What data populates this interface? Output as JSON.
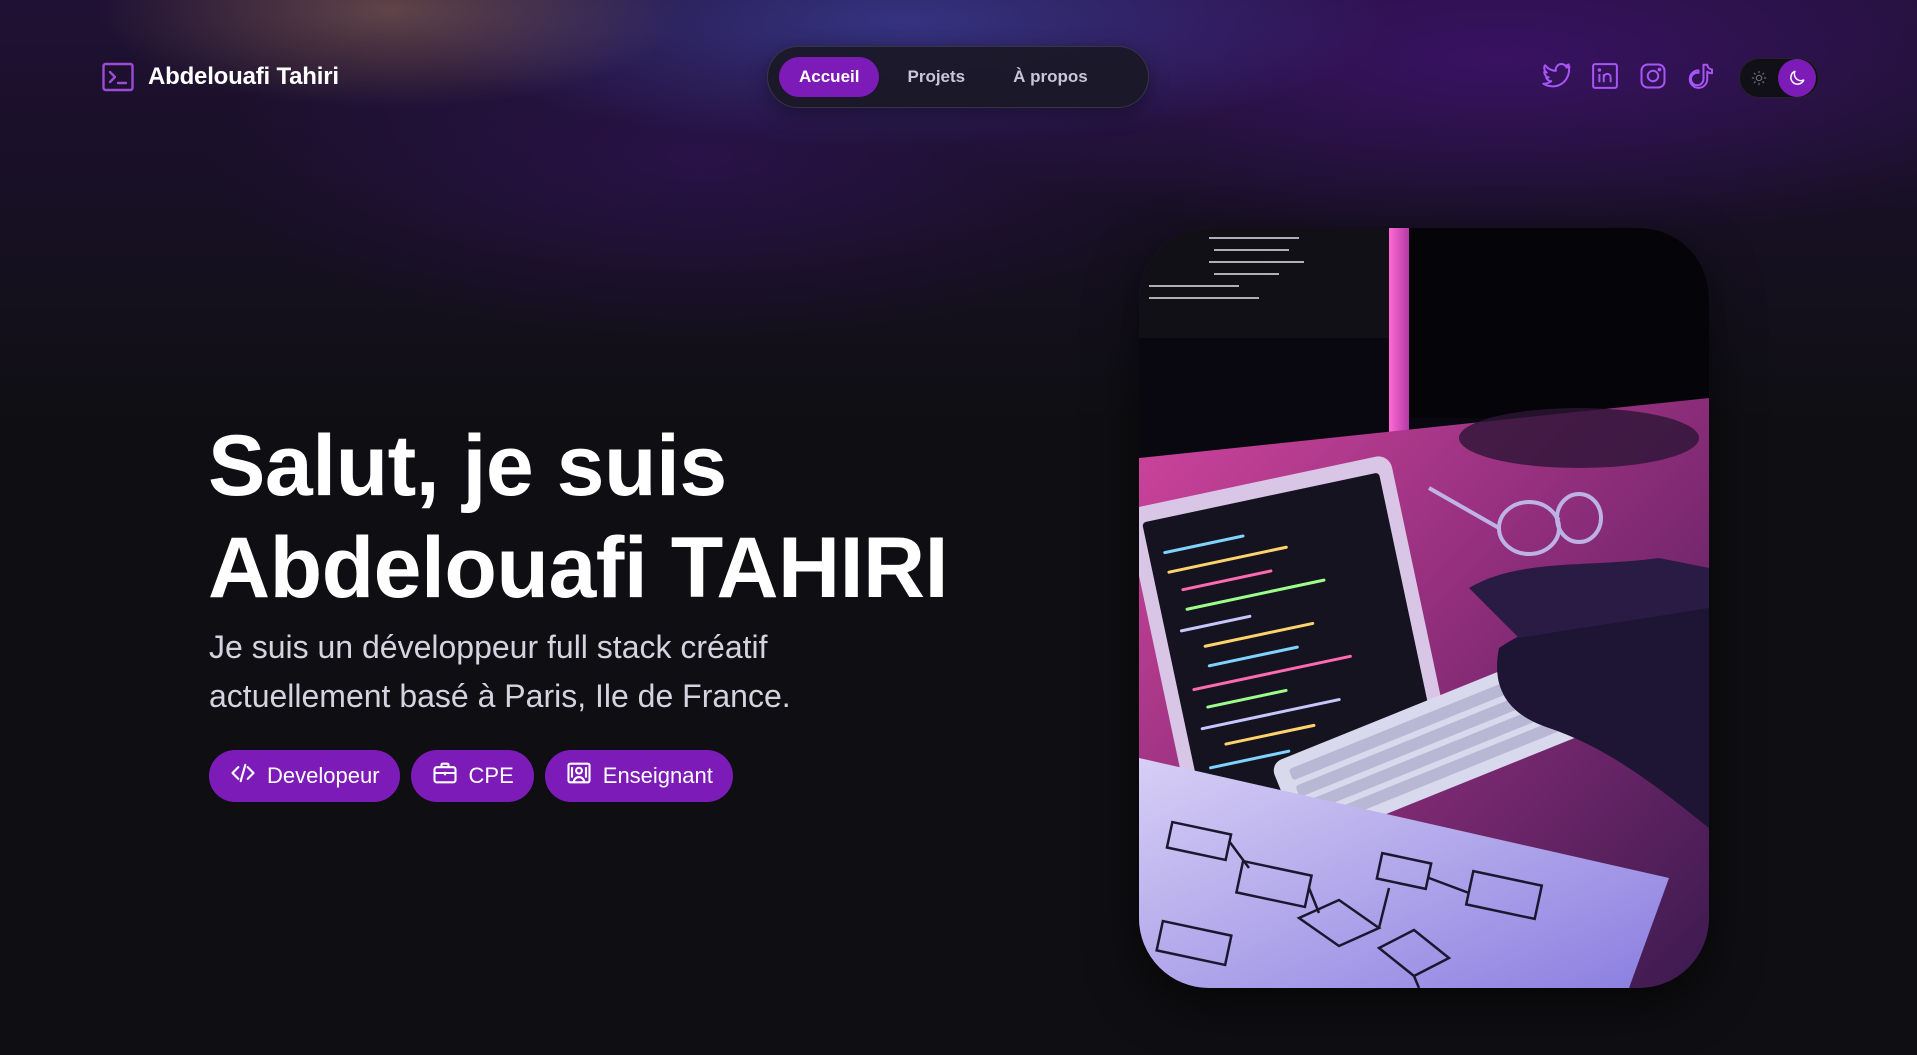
{
  "brand": {
    "name": "Abdelouafi Tahiri",
    "icon": "terminal-icon"
  },
  "nav": {
    "items": [
      {
        "label": "Accueil",
        "active": true
      },
      {
        "label": "Projets",
        "active": false
      },
      {
        "label": "À propos",
        "active": false
      }
    ]
  },
  "socials": [
    {
      "name": "twitter",
      "icon": "twitter-icon"
    },
    {
      "name": "linkedin",
      "icon": "linkedin-icon"
    },
    {
      "name": "instagram",
      "icon": "instagram-icon"
    },
    {
      "name": "tiktok",
      "icon": "tiktok-icon"
    }
  ],
  "theme_toggle": {
    "light_icon": "sun-icon",
    "dark_icon": "moon-icon",
    "selected": "dark"
  },
  "hero": {
    "title_line1": "Salut, je suis",
    "title_line2": "Abdelouafi TAHIRI",
    "subtitle_line1": "Je suis un développeur full stack créatif",
    "subtitle_line2": "actuellement basé à Paris, Ile de France.",
    "tags": [
      {
        "label": "Developeur",
        "icon": "code-icon"
      },
      {
        "label": "CPE",
        "icon": "briefcase-icon"
      },
      {
        "label": "Enseignant",
        "icon": "presentation-icon"
      }
    ],
    "photo": "developer-workspace-photo"
  },
  "colors": {
    "accent": "#7c1bb8",
    "icon_purple": "#a855f7",
    "background": "#0f0f13",
    "nav_background": "#1a1826"
  }
}
